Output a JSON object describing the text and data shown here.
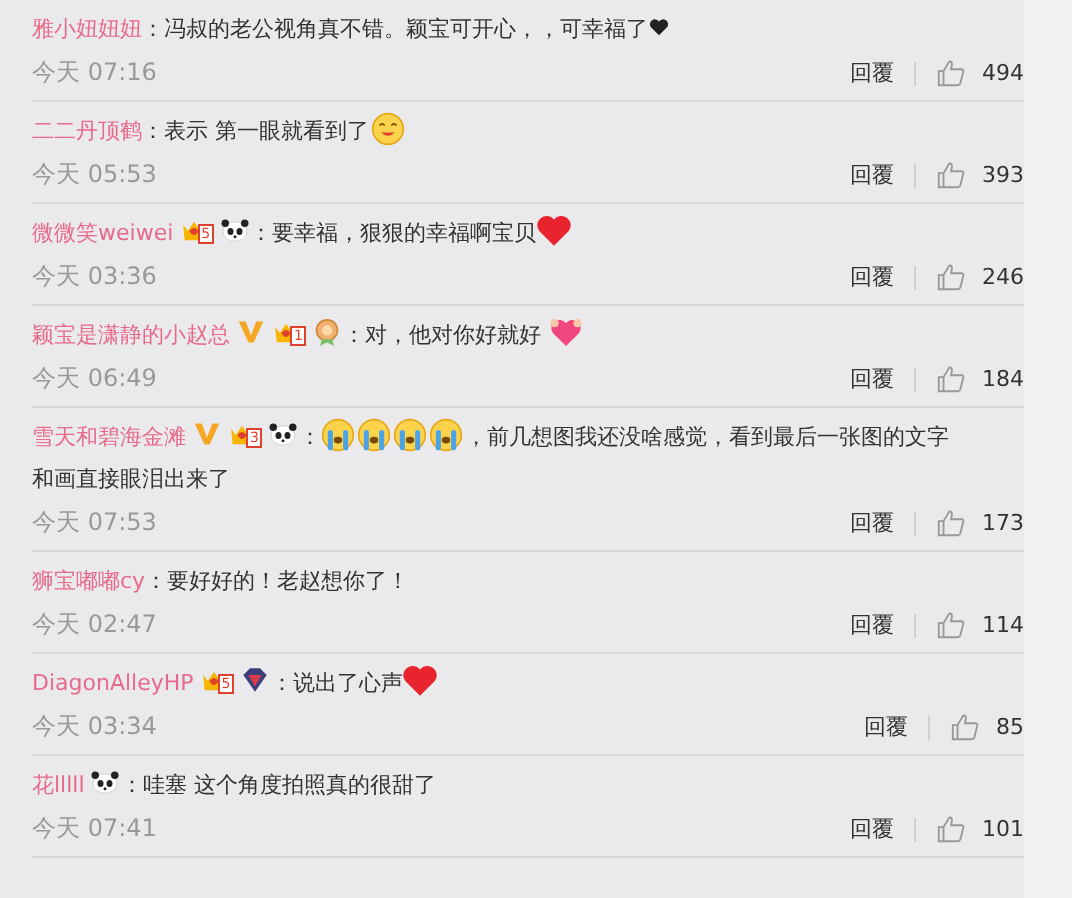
{
  "comments": [
    {
      "name": "雅小妞妞妞",
      "parts": [
        {
          "kind": "text",
          "text": "：冯叔的老公视角真不错。颖宝可开心，，可幸福了"
        },
        {
          "kind": "black-heart"
        }
      ],
      "time": "今天 07:16",
      "reply": "回覆",
      "likes": "494"
    },
    {
      "name": "二二丹顶鹤",
      "parts": [
        {
          "kind": "text",
          "text": "：表示  第一眼就看到了"
        },
        {
          "kind": "yum-face"
        }
      ],
      "time": "今天 05:53",
      "reply": "回覆",
      "likes": "393"
    },
    {
      "name": "微微笑weiwei",
      "badges": [
        {
          "kind": "fan",
          "label": "5"
        },
        {
          "kind": "panda"
        }
      ],
      "parts": [
        {
          "kind": "text",
          "text": "：要幸福，狠狠的幸福啊宝贝"
        },
        {
          "kind": "red-heart"
        }
      ],
      "time": "今天 03:36",
      "reply": "回覆",
      "likes": "246"
    },
    {
      "name": "颖宝是潇静的小赵总",
      "badges": [
        {
          "kind": "verified"
        },
        {
          "kind": "fan",
          "label": "1"
        },
        {
          "kind": "medal"
        }
      ],
      "parts": [
        {
          "kind": "text",
          "text": "：对，他对你好就好 "
        },
        {
          "kind": "pink-heart"
        }
      ],
      "time": "今天 06:49",
      "reply": "回覆",
      "likes": "184"
    },
    {
      "name": "雪天和碧海金滩",
      "badges": [
        {
          "kind": "verified"
        },
        {
          "kind": "fan",
          "label": "3"
        },
        {
          "kind": "panda"
        }
      ],
      "parts": [
        {
          "kind": "text",
          "text": "："
        },
        {
          "kind": "crying-face"
        },
        {
          "kind": "crying-face"
        },
        {
          "kind": "crying-face"
        },
        {
          "kind": "crying-face"
        },
        {
          "kind": "text",
          "text": "，前几想图我还没啥感觉，看到最后一张图的文字"
        },
        {
          "kind": "new-line",
          "text": "和画直接眼泪出来了"
        }
      ],
      "time": "今天 07:53",
      "reply": "回覆",
      "likes": "173"
    },
    {
      "name": "狮宝嘟嘟cy",
      "parts": [
        {
          "kind": "text",
          "text": "：要好好的！老赵想你了！"
        }
      ],
      "time": "今天 02:47",
      "reply": "回覆",
      "likes": "114"
    },
    {
      "name": "DiagonAlleyHP",
      "badges": [
        {
          "kind": "fan",
          "label": "5"
        },
        {
          "kind": "gem"
        }
      ],
      "parts": [
        {
          "kind": "text",
          "text": "：说出了心声"
        },
        {
          "kind": "red-heart"
        }
      ],
      "time": "今天 03:34",
      "reply": "回覆",
      "likes": "85"
    },
    {
      "name": "花lllll",
      "badges": [
        {
          "kind": "panda"
        }
      ],
      "parts": [
        {
          "kind": "text",
          "text": "：哇塞 这个角度拍照真的很甜了"
        }
      ],
      "time": "今天 07:41",
      "reply": "回覆",
      "likes": "101"
    }
  ]
}
